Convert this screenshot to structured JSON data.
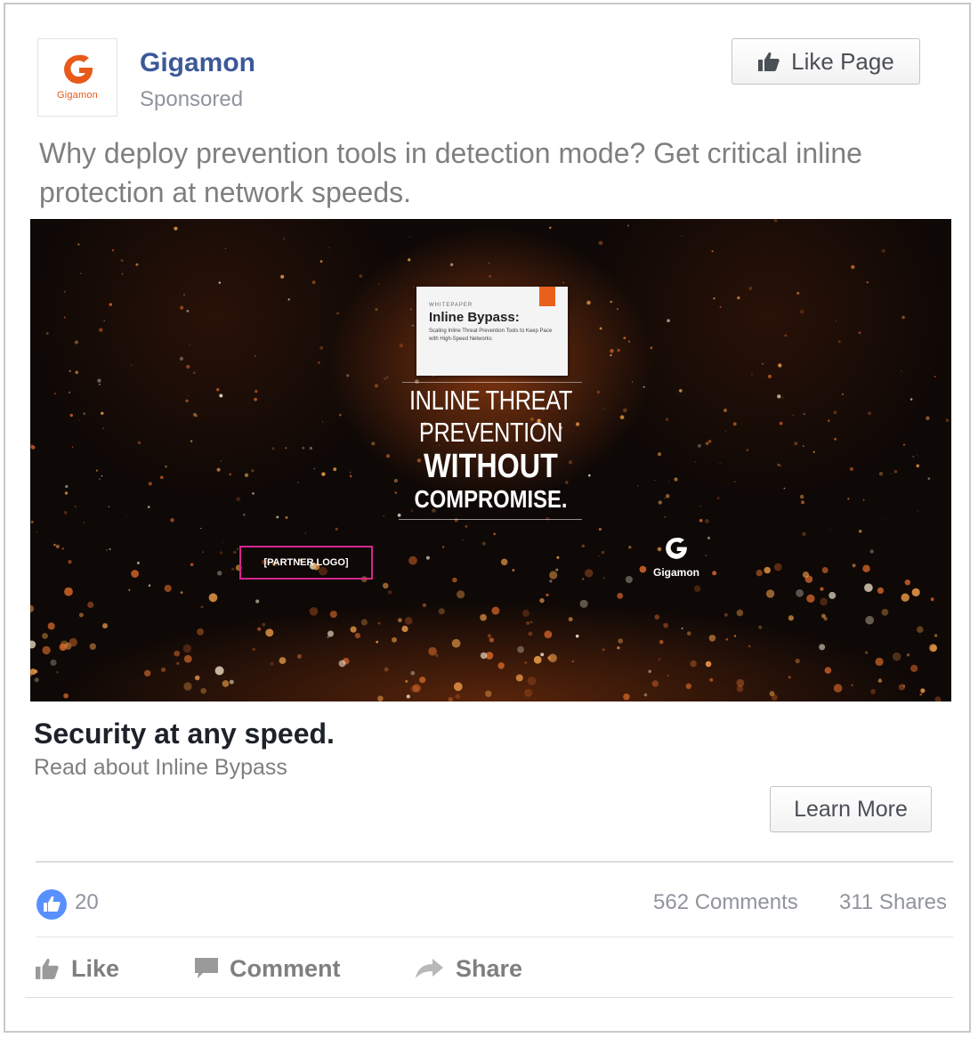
{
  "post": {
    "page_name": "Gigamon",
    "sponsored_label": "Sponsored",
    "logo_text": "Gigamon",
    "like_page_label": "Like Page",
    "text": "Why deploy prevention tools in detection mode? Get critical inline protection at network speeds."
  },
  "ad_image": {
    "whitepaper_tag": "WHITEPAPER",
    "whitepaper_title": "Inline Bypass:",
    "whitepaper_subtitle": "Scaling Inline Threat Prevention Tools to Keep Pace with High-Speed Networks",
    "headline_line1": "INLINE THREAT",
    "headline_line2": "PREVENTION",
    "headline_line3": "WITHOUT",
    "headline_line4": "COMPROMISE.",
    "partner_logo_label": "[PARTNER LOGO]",
    "brand_logo_text": "Gigamon"
  },
  "link": {
    "title": "Security at any speed.",
    "description": "Read about Inline Bypass",
    "cta_label": "Learn More"
  },
  "stats": {
    "likes": "20",
    "comments": "562 Comments",
    "shares": "311 Shares"
  },
  "actions": {
    "like": "Like",
    "comment": "Comment",
    "share": "Share"
  },
  "colors": {
    "brand_blue": "#3b5998",
    "brand_orange": "#e85a1a",
    "reaction_blue": "#5890ff",
    "partner_border": "#d6258f"
  }
}
